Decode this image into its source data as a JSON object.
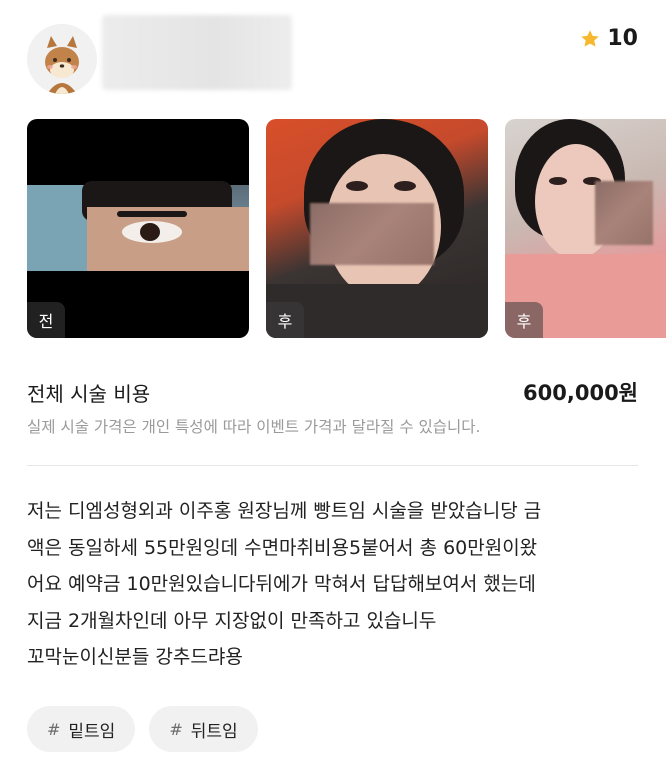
{
  "header": {
    "avatar_icon": "shiba-dog-icon",
    "rating": "10",
    "rating_icon": "star-icon",
    "rating_color": "#f5b82e"
  },
  "photos": [
    {
      "tag": "전"
    },
    {
      "tag": "후"
    },
    {
      "tag": "후"
    }
  ],
  "cost": {
    "label": "전체 시술 비용",
    "value": "600,000원",
    "note": "실제 시술 가격은 개인 특성에 따라 이벤트 가격과 달라질 수 있습니다."
  },
  "review": {
    "lines": [
      "저는 디엠성형외과 이주홍 원장님께 빵트임 시술을 받았습니당 금",
      "액은 동일하세 55만원잉데 수면마취비용5붙어서 총 60만원이왔",
      "어요 예약금 10만원있습니다뒤에가 막혀서 답답해보여서 했는데",
      "지금 2개월차인데 아무 지장없이 만족하고 있습니두",
      "꼬막눈이신분들 강추드랴용"
    ]
  },
  "hashtags": [
    {
      "symbol": "#",
      "label": "밑트임"
    },
    {
      "symbol": "#",
      "label": "뒤트임"
    }
  ]
}
